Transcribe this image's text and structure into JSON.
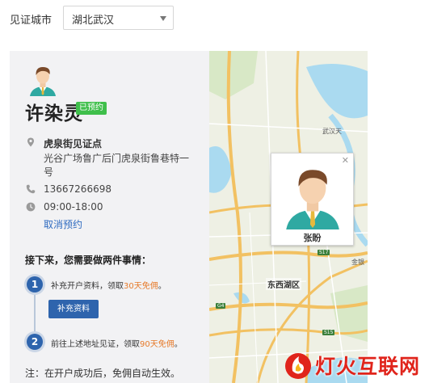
{
  "city": {
    "label": "见证城市",
    "selected": "湖北武汉"
  },
  "witness": {
    "name": "许染灵",
    "status": "已预约",
    "site_name": "虎泉街见证点",
    "address": "光谷广场鲁广后门虎泉街鲁巷特一号",
    "phone": "13667266698",
    "hours": "09:00-18:00",
    "cancel_label": "取消预约"
  },
  "todo": {
    "title": "接下来，您需要做两件事情：",
    "steps": [
      {
        "num": "1",
        "text": "补充开户资料，领取",
        "highlight": "30天免佣",
        "suffix": "。",
        "button": "补充资料"
      },
      {
        "num": "2",
        "text": "前往上述地址见证，领取",
        "highlight": "90天免佣",
        "suffix": "。"
      }
    ],
    "note": "注：在开户成功后，免佣自动生效。"
  },
  "map": {
    "labels": [
      "武汉天",
      "东西湖区",
      "金银"
    ],
    "road_signs": [
      "S17",
      "G4",
      "S15"
    ],
    "popup_name": "张盼"
  },
  "watermark": {
    "text": "灯火互联网"
  },
  "colors": {
    "accent_blue": "#2e64ad",
    "status_green": "#3fbf4b",
    "highlight_orange": "#e67a2a",
    "link_blue": "#2f6bc0",
    "watermark_red": "#e0241b"
  }
}
